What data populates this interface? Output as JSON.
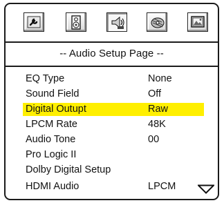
{
  "toolbar": {
    "icons": [
      "wrench-icon",
      "speaker-icon",
      "audio-speaker-icon",
      "disc-icon",
      "picture-icon"
    ],
    "active_index": 2
  },
  "page_title": "-- Audio Setup Page --",
  "menu": {
    "items": [
      {
        "label": "EQ Type",
        "value": "None"
      },
      {
        "label": "Sound Field",
        "value": "Off"
      },
      {
        "label": "Digital Outupt",
        "value": "Raw"
      },
      {
        "label": "LPCM Rate",
        "value": "48K"
      },
      {
        "label": "Audio Tone",
        "value": "00"
      },
      {
        "label": "Pro Logic II",
        "value": ""
      },
      {
        "label": "Dolby Digital Setup",
        "value": ""
      },
      {
        "label": "HDMI Audio",
        "value": "LPCM"
      }
    ],
    "selected_index": 2,
    "highlight_color": "#ffef00"
  },
  "scroll": {
    "icon": "down-arrow-icon"
  }
}
